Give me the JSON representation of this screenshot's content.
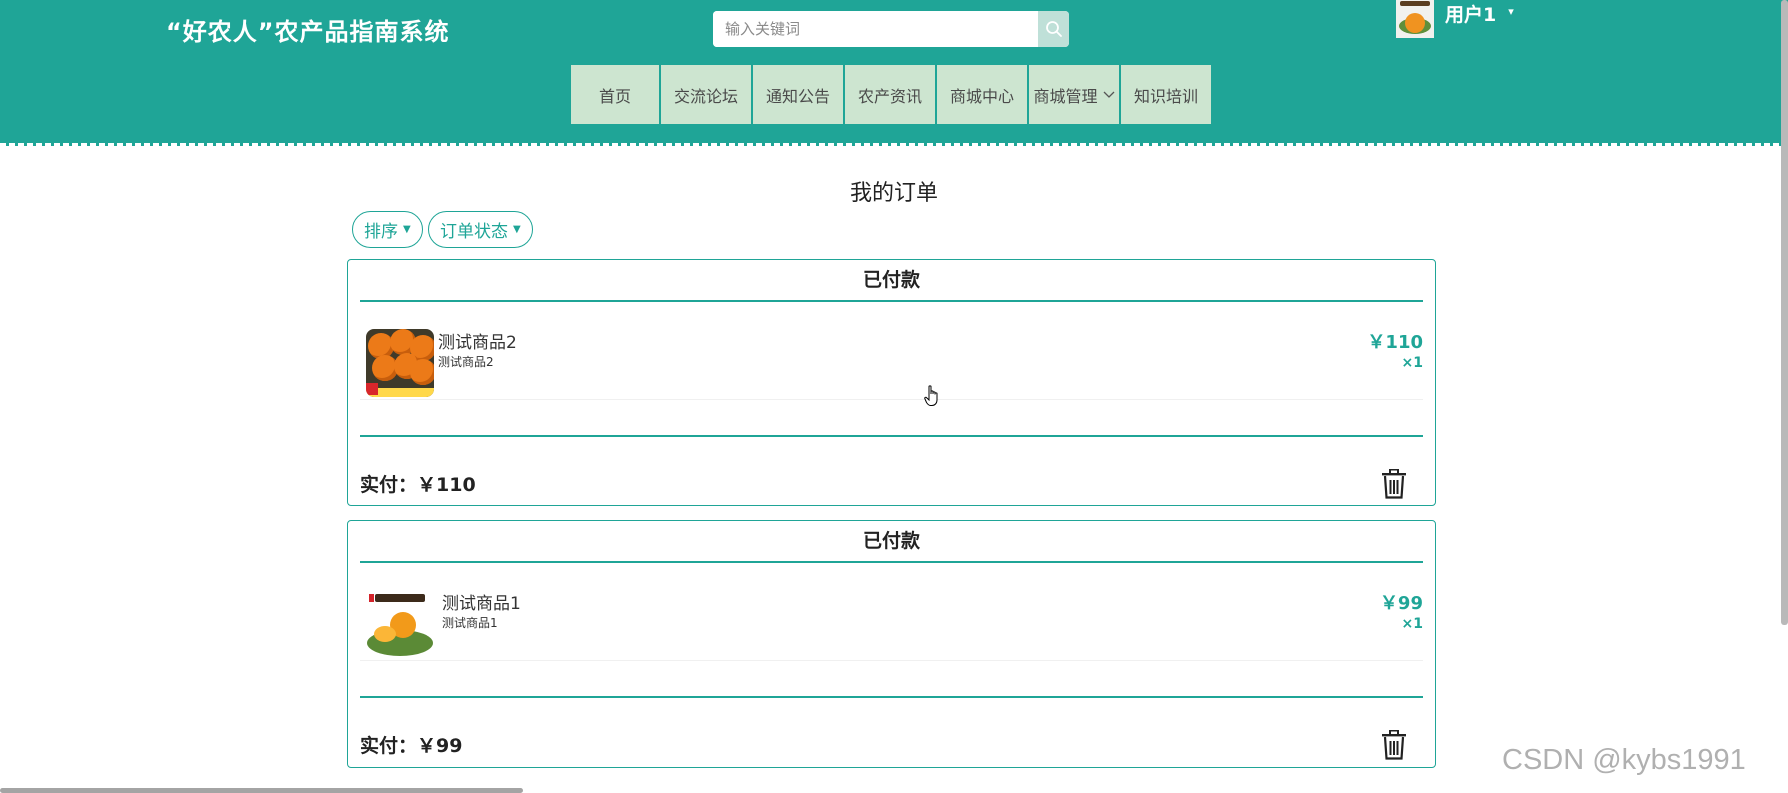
{
  "header": {
    "site_title": "“好农人”农产品指南系统",
    "search_placeholder": "输入关键词",
    "search_icon": "search-icon",
    "user_name": "用户1",
    "user_caret": "▾"
  },
  "nav": {
    "items": [
      {
        "label": "首页"
      },
      {
        "label": "交流论坛"
      },
      {
        "label": "通知公告"
      },
      {
        "label": "农产资讯"
      },
      {
        "label": "商城中心"
      },
      {
        "label": "商城管理"
      },
      {
        "label": "知识培训"
      }
    ]
  },
  "main": {
    "title": "我的订单",
    "filters": {
      "sort_label": "排序",
      "status_label": "订单状态"
    }
  },
  "orders": [
    {
      "status": "已付款",
      "item": {
        "name": "测试商品2",
        "desc": "测试商品2",
        "price": "￥110",
        "qty": "×1"
      },
      "paid_text": "实付：￥110"
    },
    {
      "status": "已付款",
      "item": {
        "name": "测试商品1",
        "desc": "测试商品1",
        "price": "￥99",
        "qty": "×1"
      },
      "paid_text": "实付：￥99"
    }
  ],
  "watermark": "CSDN @kybs1991",
  "colors": {
    "primary": "#1fa597",
    "nav_bg": "#cde5d0",
    "search_btn_bg": "#bfe0d8"
  }
}
